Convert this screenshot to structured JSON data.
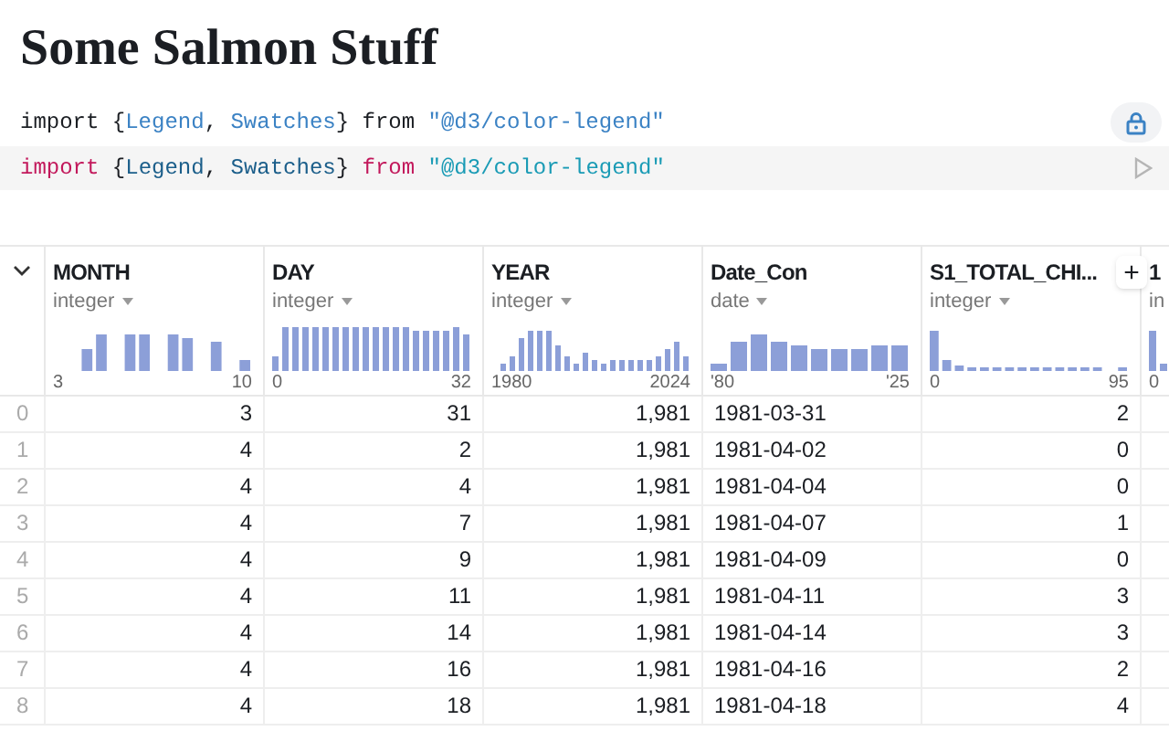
{
  "title": "Some Salmon Stuff",
  "code_output": {
    "locked": true,
    "tokens": [
      {
        "kind": "plain",
        "text": "import {"
      },
      {
        "kind": "name",
        "text": "Legend"
      },
      {
        "kind": "plain",
        "text": ", "
      },
      {
        "kind": "name",
        "text": "Swatches"
      },
      {
        "kind": "plain",
        "text": "} from "
      },
      {
        "kind": "string",
        "text": "\"@d3/color-legend\""
      }
    ]
  },
  "code_source": {
    "tokens": [
      {
        "kind": "keyword",
        "text": "import"
      },
      {
        "kind": "plain",
        "text": " {"
      },
      {
        "kind": "name",
        "text": "Legend"
      },
      {
        "kind": "plain",
        "text": ", "
      },
      {
        "kind": "name",
        "text": "Swatches"
      },
      {
        "kind": "plain",
        "text": "} "
      },
      {
        "kind": "keyword",
        "text": "from"
      },
      {
        "kind": "string",
        "text": " \"@d3/color-legend\""
      }
    ]
  },
  "table": {
    "expanded": true,
    "add_button": "+",
    "columns": [
      {
        "name": "MONTH",
        "type": "integer",
        "min": "3",
        "max": "10"
      },
      {
        "name": "DAY",
        "type": "integer",
        "min": "0",
        "max": "32"
      },
      {
        "name": "YEAR",
        "type": "integer",
        "min": "1980",
        "max": "2024"
      },
      {
        "name": "Date_Con",
        "type": "date",
        "min": "'80",
        "max": "'25"
      },
      {
        "name": "S1_TOTAL_CHI...",
        "type": "integer",
        "min": "0",
        "max": "95"
      },
      {
        "name": "1",
        "type": "in",
        "min": "0"
      }
    ],
    "rows": [
      {
        "index": "0",
        "cells": [
          "3",
          "31",
          "1,981",
          "1981-03-31",
          "2"
        ]
      },
      {
        "index": "1",
        "cells": [
          "4",
          "2",
          "1,981",
          "1981-04-02",
          "0"
        ]
      },
      {
        "index": "2",
        "cells": [
          "4",
          "4",
          "1,981",
          "1981-04-04",
          "0"
        ]
      },
      {
        "index": "3",
        "cells": [
          "4",
          "7",
          "1,981",
          "1981-04-07",
          "1"
        ]
      },
      {
        "index": "4",
        "cells": [
          "4",
          "9",
          "1,981",
          "1981-04-09",
          "0"
        ]
      },
      {
        "index": "5",
        "cells": [
          "4",
          "11",
          "1,981",
          "1981-04-11",
          "3"
        ]
      },
      {
        "index": "6",
        "cells": [
          "4",
          "14",
          "1,981",
          "1981-04-14",
          "3"
        ]
      },
      {
        "index": "7",
        "cells": [
          "4",
          "16",
          "1,981",
          "1981-04-16",
          "2"
        ]
      },
      {
        "index": "8",
        "cells": [
          "4",
          "18",
          "1,981",
          "1981-04-18",
          "4"
        ]
      }
    ]
  }
}
